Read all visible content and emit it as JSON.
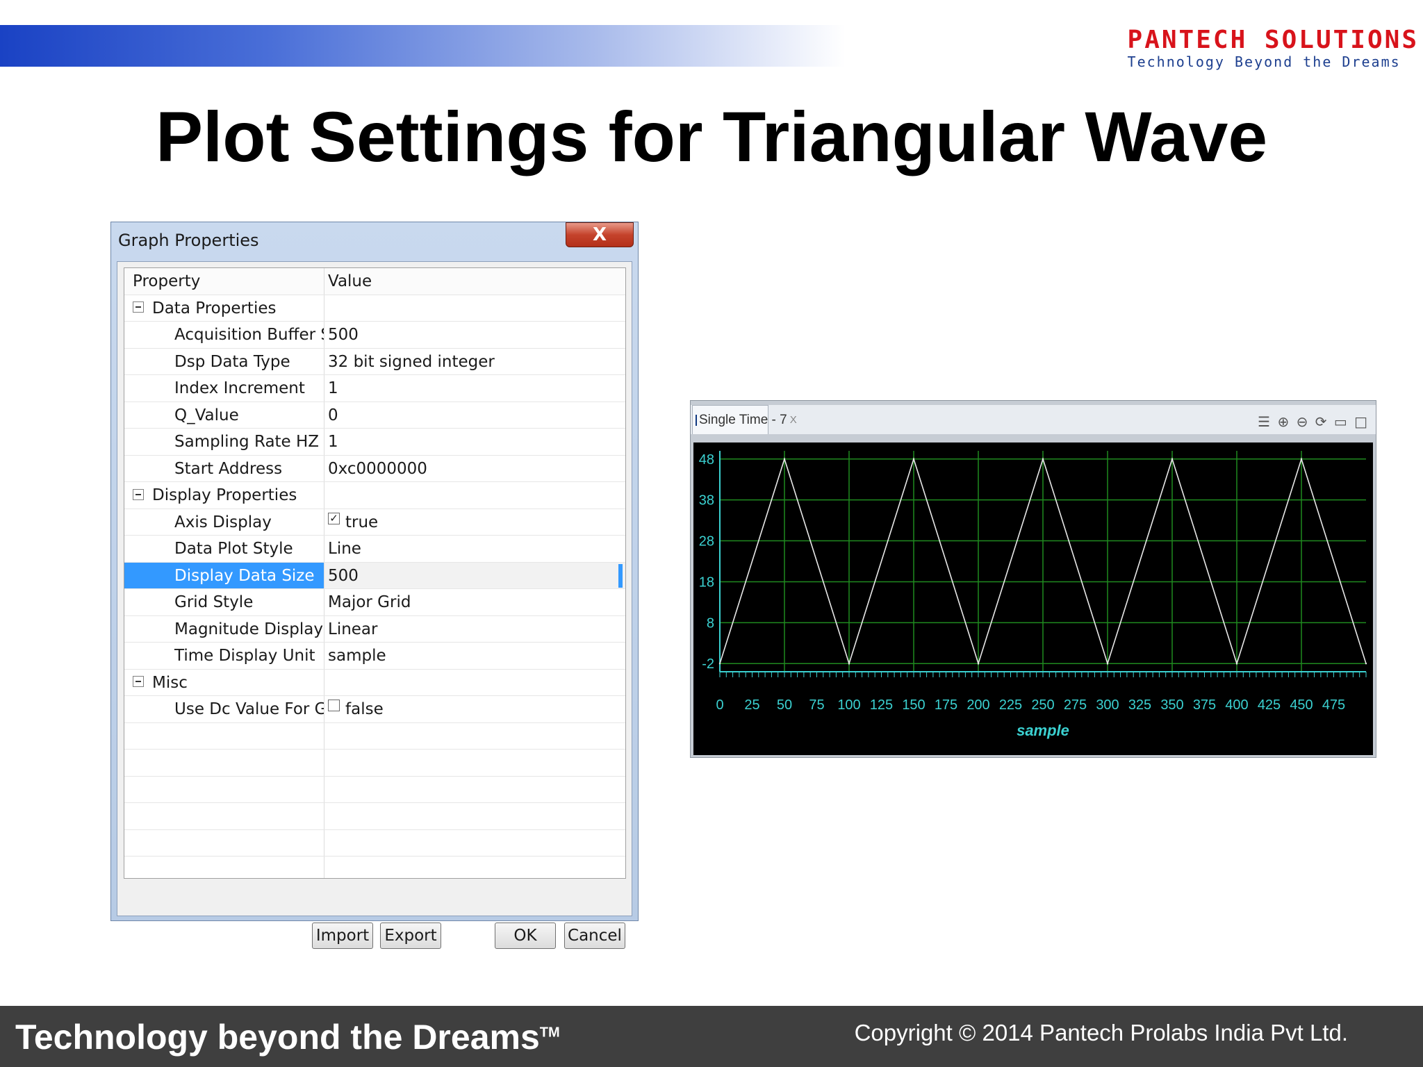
{
  "header": {
    "logo_name": "PANTECH SOLUTIONS",
    "logo_tagline": "Technology Beyond the Dreams"
  },
  "slide_title": "Plot Settings for Triangular Wave",
  "dialog": {
    "title": "Graph Properties",
    "close_label": "X",
    "columns": {
      "property": "Property",
      "value": "Value"
    },
    "rows": [
      {
        "kind": "cat",
        "property": "Data Properties",
        "value": ""
      },
      {
        "kind": "prop",
        "property": "Acquisition Buffer S",
        "value": "500"
      },
      {
        "kind": "prop",
        "property": "Dsp Data Type",
        "value": "32 bit signed integer"
      },
      {
        "kind": "prop",
        "property": "Index Increment",
        "value": "1"
      },
      {
        "kind": "prop",
        "property": "Q_Value",
        "value": "0"
      },
      {
        "kind": "prop",
        "property": "Sampling Rate HZ",
        "value": "1"
      },
      {
        "kind": "prop",
        "property": "Start Address",
        "value": "0xc0000000"
      },
      {
        "kind": "cat",
        "property": "Display Properties",
        "value": ""
      },
      {
        "kind": "prop",
        "property": "Axis Display",
        "value": "true",
        "checkbox": true,
        "checked": true
      },
      {
        "kind": "prop",
        "property": "Data Plot Style",
        "value": "Line"
      },
      {
        "kind": "prop",
        "property": "Display Data Size",
        "value": "500",
        "selected": true
      },
      {
        "kind": "prop",
        "property": "Grid Style",
        "value": "Major Grid"
      },
      {
        "kind": "prop",
        "property": "Magnitude Display",
        "value": "Linear"
      },
      {
        "kind": "prop",
        "property": "Time Display Unit",
        "value": "sample"
      },
      {
        "kind": "cat",
        "property": "Misc",
        "value": ""
      },
      {
        "kind": "prop",
        "property": "Use Dc Value For Gi",
        "value": "false",
        "checkbox": true,
        "checked": false
      }
    ],
    "empty_rows": 6,
    "buttons": {
      "import": "Import",
      "export": "Export",
      "ok": "OK",
      "cancel": "Cancel"
    }
  },
  "plot_window": {
    "tab_label": "Single Time - 7",
    "tab_close": "X",
    "toolbar_icons": [
      "properties-icon",
      "zoom-in-icon",
      "zoom-out-icon",
      "refresh-icon",
      "minimize-icon",
      "maximize-icon"
    ],
    "colors": {
      "background": "#000000",
      "grid": "#1f8a1f",
      "trace": "#e8e8e8",
      "axis": "#3bd1d1"
    }
  },
  "chart_data": {
    "type": "line",
    "title": "",
    "xlabel": "sample",
    "ylabel": "",
    "x_ticks": [
      0,
      25,
      50,
      75,
      100,
      125,
      150,
      175,
      200,
      225,
      250,
      275,
      300,
      325,
      350,
      375,
      400,
      425,
      450,
      475
    ],
    "y_ticks": [
      -2,
      8,
      18,
      28,
      38,
      48
    ],
    "xlim": [
      0,
      500
    ],
    "ylim": [
      -4,
      50
    ],
    "grid": true,
    "series": [
      {
        "x": [
          0,
          50,
          100,
          150,
          200,
          250,
          300,
          350,
          400,
          450,
          500
        ],
        "y": [
          -2,
          48,
          -2,
          48,
          -2,
          48,
          -2,
          48,
          -2,
          48,
          -2
        ]
      }
    ]
  },
  "footer": {
    "tagline": "Technology beyond the Dreams",
    "tm": "TM",
    "copyright": "Copyright © 2014 Pantech Prolabs India Pvt Ltd."
  }
}
